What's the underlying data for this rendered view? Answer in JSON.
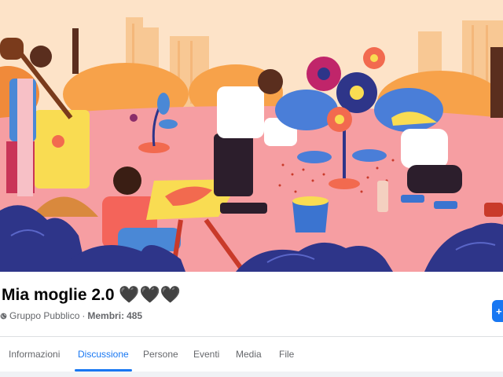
{
  "group": {
    "name": "Mia moglie 2.0 🖤🖤🖤",
    "privacy": "Gruppo Pubblico",
    "separator": "·",
    "members_label": "Membri:",
    "members_count": "485"
  },
  "tabs": [
    {
      "label": "Informazioni",
      "active": false
    },
    {
      "label": "Discussione",
      "active": true
    },
    {
      "label": "Persone",
      "active": false
    },
    {
      "label": "Eventi",
      "active": false
    },
    {
      "label": "Media",
      "active": false
    },
    {
      "label": "File",
      "active": false
    }
  ],
  "colors": {
    "accent": "#1877f2",
    "cover_sky": "#fde0c4",
    "cover_ground": "#f59ca0",
    "bush": "#2e3589"
  }
}
